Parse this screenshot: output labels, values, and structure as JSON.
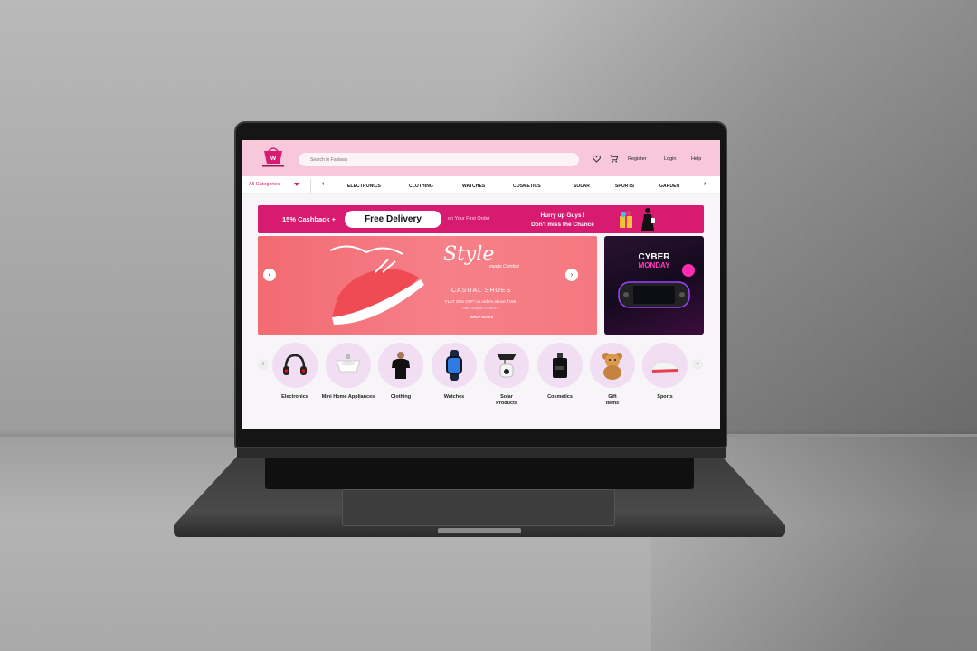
{
  "header": {
    "search_placeholder": "Search In Fastway",
    "register_label": "Register",
    "login_label": "Login",
    "help_label": "Help",
    "wishlist_icon": "heart-icon",
    "cart_icon": "cart-icon"
  },
  "category_bar": {
    "all_categories_label": "All Categories",
    "items": [
      "ELECTRONICS",
      "CLOTHING",
      "WATCHES",
      "COSMETICS",
      "SOLAR",
      "SPORTS",
      "GARDEN"
    ]
  },
  "promo_banner": {
    "cashback_text": "15% Cashback +",
    "free_delivery_label": "Free Delivery",
    "first_order_text": "on Your First Order",
    "hurry_line1": "Hurry up Guys !",
    "hurry_line2": "Don't miss the Chance"
  },
  "hero": {
    "style_text": "Style",
    "meets_text": "meets Comfort",
    "category_text": "CASUAL SHOES",
    "offer_text": "FLAT 25% OFF* on orders above ₹150",
    "coupon_text": "Use Coupon FC25OFF",
    "shop_now_text": "SHOP NOW ▸"
  },
  "side_banner": {
    "title": "CYBER",
    "subtitle": "MONDAY"
  },
  "categories": [
    {
      "label": "Electronics",
      "icon": "headphones-icon"
    },
    {
      "label": "Mini Home Appliances",
      "icon": "sink-icon"
    },
    {
      "label": "Clothing",
      "icon": "tshirt-icon"
    },
    {
      "label": "Watches",
      "icon": "smartwatch-icon"
    },
    {
      "label": "Solar Products",
      "icon": "solar-light-icon"
    },
    {
      "label": "Cosmetics",
      "icon": "perfume-icon"
    },
    {
      "label": "Gift Items",
      "icon": "teddy-bear-icon"
    },
    {
      "label": "Sports",
      "icon": "sneaker-icon"
    }
  ],
  "colors": {
    "brand_pink": "#d81b70",
    "header_pink": "#f8c8da",
    "hero_coral": "#f26a72",
    "circle_bg": "#f1def3"
  }
}
